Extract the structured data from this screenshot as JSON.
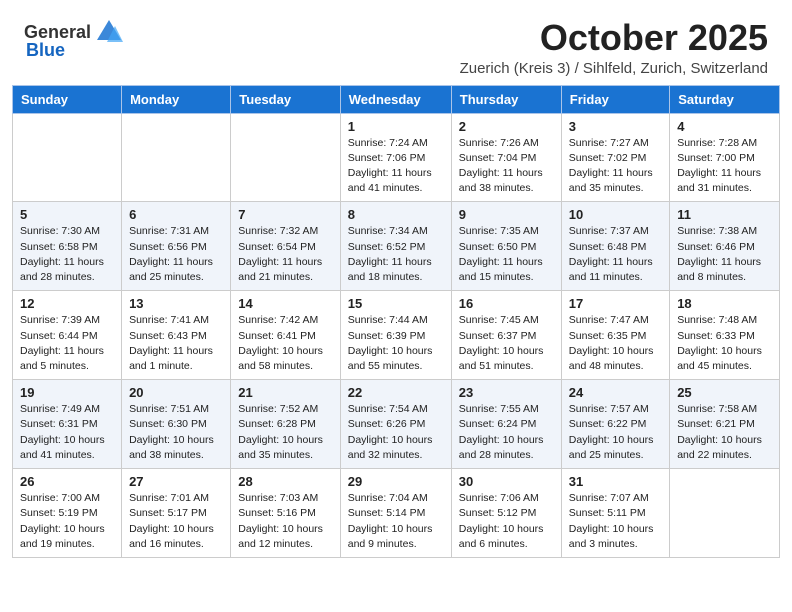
{
  "header": {
    "logo_general": "General",
    "logo_blue": "Blue",
    "month": "October 2025",
    "location": "Zuerich (Kreis 3) / Sihlfeld, Zurich, Switzerland"
  },
  "days_of_week": [
    "Sunday",
    "Monday",
    "Tuesday",
    "Wednesday",
    "Thursday",
    "Friday",
    "Saturday"
  ],
  "weeks": [
    [
      {
        "day": "",
        "info": ""
      },
      {
        "day": "",
        "info": ""
      },
      {
        "day": "",
        "info": ""
      },
      {
        "day": "1",
        "info": "Sunrise: 7:24 AM\nSunset: 7:06 PM\nDaylight: 11 hours and 41 minutes."
      },
      {
        "day": "2",
        "info": "Sunrise: 7:26 AM\nSunset: 7:04 PM\nDaylight: 11 hours and 38 minutes."
      },
      {
        "day": "3",
        "info": "Sunrise: 7:27 AM\nSunset: 7:02 PM\nDaylight: 11 hours and 35 minutes."
      },
      {
        "day": "4",
        "info": "Sunrise: 7:28 AM\nSunset: 7:00 PM\nDaylight: 11 hours and 31 minutes."
      }
    ],
    [
      {
        "day": "5",
        "info": "Sunrise: 7:30 AM\nSunset: 6:58 PM\nDaylight: 11 hours and 28 minutes."
      },
      {
        "day": "6",
        "info": "Sunrise: 7:31 AM\nSunset: 6:56 PM\nDaylight: 11 hours and 25 minutes."
      },
      {
        "day": "7",
        "info": "Sunrise: 7:32 AM\nSunset: 6:54 PM\nDaylight: 11 hours and 21 minutes."
      },
      {
        "day": "8",
        "info": "Sunrise: 7:34 AM\nSunset: 6:52 PM\nDaylight: 11 hours and 18 minutes."
      },
      {
        "day": "9",
        "info": "Sunrise: 7:35 AM\nSunset: 6:50 PM\nDaylight: 11 hours and 15 minutes."
      },
      {
        "day": "10",
        "info": "Sunrise: 7:37 AM\nSunset: 6:48 PM\nDaylight: 11 hours and 11 minutes."
      },
      {
        "day": "11",
        "info": "Sunrise: 7:38 AM\nSunset: 6:46 PM\nDaylight: 11 hours and 8 minutes."
      }
    ],
    [
      {
        "day": "12",
        "info": "Sunrise: 7:39 AM\nSunset: 6:44 PM\nDaylight: 11 hours and 5 minutes."
      },
      {
        "day": "13",
        "info": "Sunrise: 7:41 AM\nSunset: 6:43 PM\nDaylight: 11 hours and 1 minute."
      },
      {
        "day": "14",
        "info": "Sunrise: 7:42 AM\nSunset: 6:41 PM\nDaylight: 10 hours and 58 minutes."
      },
      {
        "day": "15",
        "info": "Sunrise: 7:44 AM\nSunset: 6:39 PM\nDaylight: 10 hours and 55 minutes."
      },
      {
        "day": "16",
        "info": "Sunrise: 7:45 AM\nSunset: 6:37 PM\nDaylight: 10 hours and 51 minutes."
      },
      {
        "day": "17",
        "info": "Sunrise: 7:47 AM\nSunset: 6:35 PM\nDaylight: 10 hours and 48 minutes."
      },
      {
        "day": "18",
        "info": "Sunrise: 7:48 AM\nSunset: 6:33 PM\nDaylight: 10 hours and 45 minutes."
      }
    ],
    [
      {
        "day": "19",
        "info": "Sunrise: 7:49 AM\nSunset: 6:31 PM\nDaylight: 10 hours and 41 minutes."
      },
      {
        "day": "20",
        "info": "Sunrise: 7:51 AM\nSunset: 6:30 PM\nDaylight: 10 hours and 38 minutes."
      },
      {
        "day": "21",
        "info": "Sunrise: 7:52 AM\nSunset: 6:28 PM\nDaylight: 10 hours and 35 minutes."
      },
      {
        "day": "22",
        "info": "Sunrise: 7:54 AM\nSunset: 6:26 PM\nDaylight: 10 hours and 32 minutes."
      },
      {
        "day": "23",
        "info": "Sunrise: 7:55 AM\nSunset: 6:24 PM\nDaylight: 10 hours and 28 minutes."
      },
      {
        "day": "24",
        "info": "Sunrise: 7:57 AM\nSunset: 6:22 PM\nDaylight: 10 hours and 25 minutes."
      },
      {
        "day": "25",
        "info": "Sunrise: 7:58 AM\nSunset: 6:21 PM\nDaylight: 10 hours and 22 minutes."
      }
    ],
    [
      {
        "day": "26",
        "info": "Sunrise: 7:00 AM\nSunset: 5:19 PM\nDaylight: 10 hours and 19 minutes."
      },
      {
        "day": "27",
        "info": "Sunrise: 7:01 AM\nSunset: 5:17 PM\nDaylight: 10 hours and 16 minutes."
      },
      {
        "day": "28",
        "info": "Sunrise: 7:03 AM\nSunset: 5:16 PM\nDaylight: 10 hours and 12 minutes."
      },
      {
        "day": "29",
        "info": "Sunrise: 7:04 AM\nSunset: 5:14 PM\nDaylight: 10 hours and 9 minutes."
      },
      {
        "day": "30",
        "info": "Sunrise: 7:06 AM\nSunset: 5:12 PM\nDaylight: 10 hours and 6 minutes."
      },
      {
        "day": "31",
        "info": "Sunrise: 7:07 AM\nSunset: 5:11 PM\nDaylight: 10 hours and 3 minutes."
      },
      {
        "day": "",
        "info": ""
      }
    ]
  ],
  "alt_rows": [
    1,
    3
  ]
}
